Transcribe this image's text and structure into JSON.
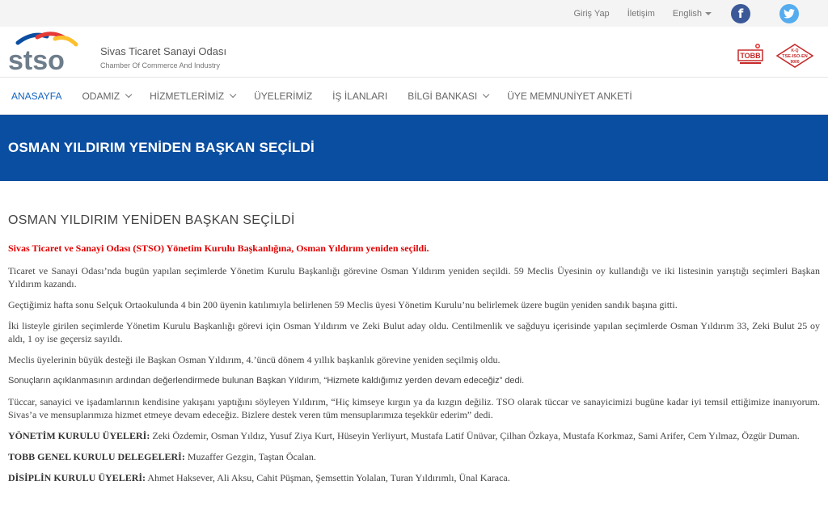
{
  "topbar": {
    "login": "Giriş Yap",
    "contact": "İletişim",
    "language": "English",
    "facebook_icon": "facebook-icon",
    "twitter_icon": "twitter-icon"
  },
  "header": {
    "org_name": "Sivas Ticaret Sanayi Odası",
    "org_subtitle": "Chamber Of Commerce And Industry",
    "logo_text": "stso",
    "tobb_badge": "TOBB",
    "tse_badge_top": "K-Q",
    "tse_badge_mid": "TSE-ISO-EN",
    "tse_badge_bottom": "9000"
  },
  "nav": {
    "items": [
      {
        "label": "ANASAYFA",
        "active": true,
        "dropdown": false
      },
      {
        "label": "ODAMIZ",
        "active": false,
        "dropdown": true
      },
      {
        "label": "HİZMETLERİMİZ",
        "active": false,
        "dropdown": true
      },
      {
        "label": "ÜYELERİMİZ",
        "active": false,
        "dropdown": false
      },
      {
        "label": "İŞ İLANLARI",
        "active": false,
        "dropdown": false
      },
      {
        "label": "BİLGİ BANKASI",
        "active": false,
        "dropdown": true
      },
      {
        "label": "ÜYE MEMNUNİYET ANKETİ",
        "active": false,
        "dropdown": false
      }
    ]
  },
  "banner": {
    "title": "OSMAN YILDIRIM YENİDEN BAŞKAN SEÇİLDİ"
  },
  "article": {
    "heading": "OSMAN YILDIRIM YENİDEN BAŞKAN SEÇİLDİ",
    "lead": "Sivas Ticaret ve Sanayi Odası (STSO) Yönetim Kurulu Başkanlığına, Osman Yıldırım yeniden seçildi.",
    "p1": "Ticaret ve Sanayi Odası’nda bugün yapılan seçimlerde Yönetim Kurulu Başkanlığı görevine Osman Yıldırım yeniden seçildi. 59 Meclis Üyesinin oy kullandığı ve iki listesinin yarıştığı seçimleri Başkan Yıldırım kazandı.",
    "p2": "Geçtiğimiz hafta sonu Selçuk Ortaokulunda 4 bin 200 üyenin katılımıyla belirlenen 59 Meclis üyesi Yönetim Kurulu’nu belirlemek üzere bugün yeniden sandık başına gitti.",
    "p3": "İki listeyle girilen seçimlerde Yönetim Kurulu Başkanlığı görevi için Osman Yıldırım ve Zeki Bulut aday oldu. Centilmenlik ve sağduyu içerisinde yapılan seçimlerde Osman Yıldırım 33, Zeki Bulut 25 oy aldı, 1 oy ise geçersiz sayıldı.",
    "p4": "Meclis üyelerinin büyük desteği ile Başkan Osman Yıldırım, 4.’üncü dönem 4 yıllık başkanlık görevine yeniden seçilmiş oldu.",
    "p5": "Sonuçların açıklanmasının ardından değerlendirmede bulunan Başkan Yıldırım, “Hizmete kaldığımız yerden devam edeceğiz” dedi.",
    "p6": "Tüccar, sanayici ve işadamlarının kendisine yakışanı yaptığını söyleyen Yıldırım, “Hiç kimseye kırgın ya da kızgın değiliz. TSO olarak tüccar ve sanayicimizi bugüne kadar iyi temsil ettiğimize inanıyorum. Sivas’a ve mensuplarımıza hizmet etmeye devam edeceğiz. Bizlere destek veren tüm mensuplarımıza  teşekkür ederim” dedi.",
    "board_label": "YÖNETİM KURULU ÜYELERİ:",
    "board_text": " Zeki Özdemir, Osman Yıldız, Yusuf Ziya Kurt, Hüseyin Yerliyurt, Mustafa Latif Ünüvar, Çilhan Özkaya, Mustafa Korkmaz, Sami Arifer, Cem Yılmaz, Özgür Duman.",
    "tobb_label": "TOBB GENEL KURULU DELEGELERİ:",
    "tobb_text": " Muzaffer Gezgin, Taştan Öcalan.",
    "discipline_label": "DİSİPLİN KURULU ÜYELERİ:",
    "discipline_text": " Ahmet Haksever, Ali Aksu, Cahit Püşman, Şemsettin Yolalan, Turan Yıldırımlı, Ünal Karaca."
  }
}
